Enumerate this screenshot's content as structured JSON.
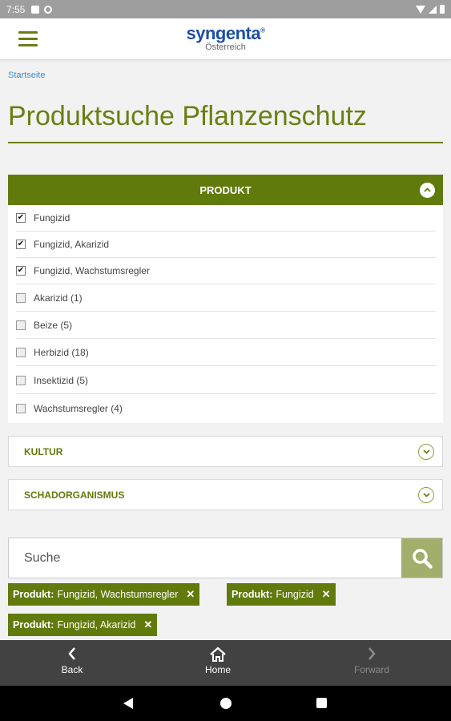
{
  "status_bar": {
    "time": "7:55"
  },
  "header": {
    "logo_text": "syngenta",
    "logo_mark": "®",
    "logo_subtitle": "Österreich"
  },
  "breadcrumb": "Startseite",
  "page_title": "Produktsuche Pflanzenschutz",
  "produkt_panel": {
    "title": "PRODUKT",
    "toggle_icon": "chevron-up-icon",
    "options": [
      {
        "label": "Fungizid",
        "checked": true
      },
      {
        "label": "Fungizid, Akarizid",
        "checked": true
      },
      {
        "label": "Fungizid, Wachstumsregler",
        "checked": true
      },
      {
        "label": "Akarizid (1)",
        "checked": false
      },
      {
        "label": "Beize (5)",
        "checked": false
      },
      {
        "label": "Herbizid (18)",
        "checked": false
      },
      {
        "label": "Insektizid (5)",
        "checked": false
      },
      {
        "label": "Wachstumsregler (4)",
        "checked": false
      }
    ]
  },
  "accordions": [
    {
      "title": "KULTUR",
      "toggle_icon": "chevron-down-icon"
    },
    {
      "title": "SCHADORGANISMUS",
      "toggle_icon": "chevron-down-icon"
    }
  ],
  "search": {
    "placeholder": "Suche",
    "value": "",
    "button_icon": "search-icon"
  },
  "filter_tags": [
    {
      "prefix": "Produkt:",
      "value": "Fungizid, Wachstumsregler",
      "remove": "✕"
    },
    {
      "prefix": "Produkt:",
      "value": "Fungizid",
      "remove": "✕"
    },
    {
      "prefix": "Produkt:",
      "value": "Fungizid, Akarizid",
      "remove": "✕"
    }
  ],
  "bottom_nav": {
    "back": {
      "label": "Back",
      "icon": "chevron-left-icon"
    },
    "home": {
      "label": "Home",
      "icon": "home-icon"
    },
    "forward": {
      "label": "Forward",
      "icon": "chevron-right-icon",
      "enabled": false
    }
  },
  "colors": {
    "primary_green": "#617a0c",
    "title_green": "#6a7f12",
    "link_blue": "#3a8fc7",
    "logo_blue": "#1d4fa5",
    "search_button": "#a2ae6b",
    "nav_bar": "#424242"
  }
}
